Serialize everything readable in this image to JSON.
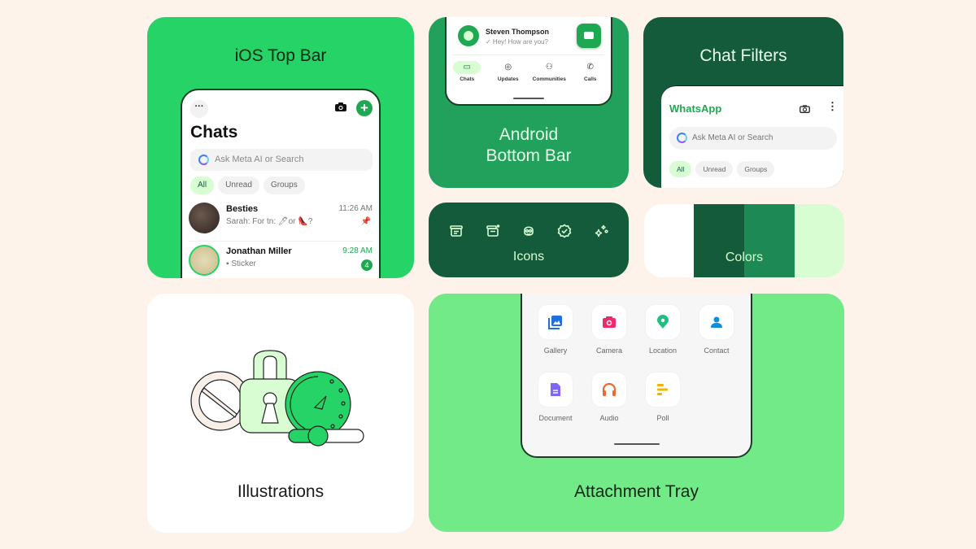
{
  "colors": {
    "background": "#fdf3ea",
    "palette": [
      "#ffffff",
      "#135b3a",
      "#1d8a55",
      "#d8fdd2"
    ]
  },
  "cards": {
    "ios": {
      "title": "iOS Top Bar",
      "screen_title": "Chats",
      "search_placeholder": "Ask Meta AI or Search",
      "chips": [
        "All",
        "Unread",
        "Groups"
      ],
      "chats": [
        {
          "name": "Besties",
          "message": "Sarah: For tn: 🖊or 👠?",
          "time": "11:26 AM",
          "pinned": true
        },
        {
          "name": "Jonathan Miller",
          "message": "Sticker",
          "time": "9:28 AM",
          "unread": "4"
        }
      ]
    },
    "android": {
      "title_line1": "Android",
      "title_line2": "Bottom Bar",
      "contact_name": "Steven Thompson",
      "contact_message": "✓ Hey! How are you?",
      "nav": [
        {
          "label": "Chats",
          "icon": "chats-icon",
          "glyph": "▭",
          "active": true
        },
        {
          "label": "Updates",
          "icon": "updates-icon",
          "glyph": "◎"
        },
        {
          "label": "Communities",
          "icon": "communities-icon",
          "glyph": "⚇"
        },
        {
          "label": "Calls",
          "icon": "calls-icon",
          "glyph": "✆"
        }
      ]
    },
    "filters": {
      "title": "Chat Filters",
      "brand": "WhatsApp",
      "search_placeholder": "Ask Meta AI or Search",
      "chips": [
        "All",
        "Unread",
        "Groups"
      ]
    },
    "icons": {
      "title": "Icons",
      "items": [
        "archive-icon",
        "archive-badge-icon",
        "avatar-icon",
        "verified-icon",
        "sparkle-icon"
      ]
    },
    "colors": {
      "title": "Colors"
    },
    "illustrations": {
      "title": "Illustrations"
    },
    "attachment": {
      "title": "Attachment Tray",
      "items": [
        {
          "label": "Gallery",
          "icon": "gallery-icon",
          "color": "#1f6fdc"
        },
        {
          "label": "Camera",
          "icon": "camera-icon",
          "color": "#f0286d"
        },
        {
          "label": "Location",
          "icon": "location-icon",
          "color": "#1fbf7f"
        },
        {
          "label": "Contact",
          "icon": "contact-icon",
          "color": "#0d8ee0"
        },
        {
          "label": "Document",
          "icon": "document-icon",
          "color": "#7f66ff"
        },
        {
          "label": "Audio",
          "icon": "audio-icon",
          "color": "#ee6a2c"
        },
        {
          "label": "Poll",
          "icon": "poll-icon",
          "color": "#f4b400"
        }
      ]
    }
  }
}
